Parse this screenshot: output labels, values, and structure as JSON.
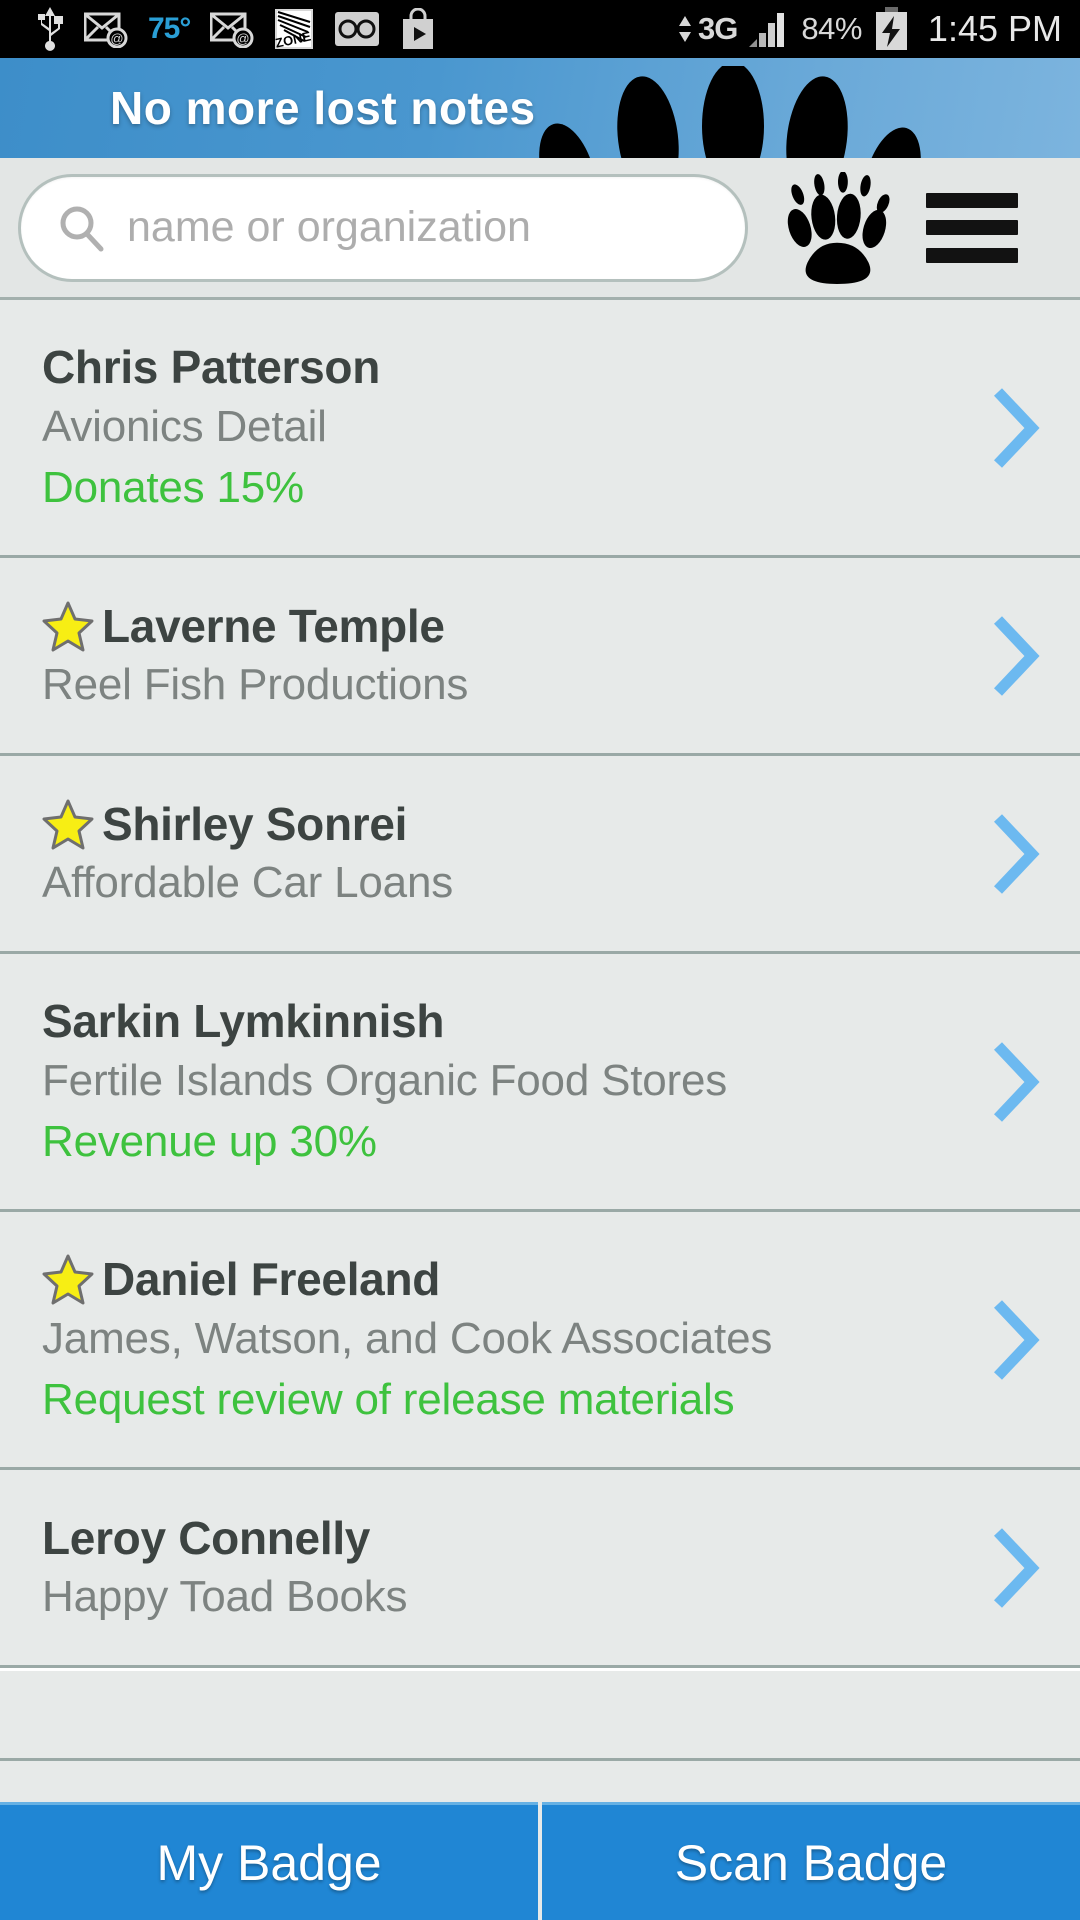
{
  "status_bar": {
    "temperature": "75°",
    "network": "3G",
    "battery": "84%",
    "time": "1:45 PM",
    "icons": [
      "usb-icon",
      "email-icon",
      "email-icon",
      "zone-icon",
      "voicemail-icon",
      "play-store-icon",
      "signal-bars-icon",
      "battery-charging-icon"
    ]
  },
  "banner": {
    "text": "No more lost notes",
    "graphic": "paw-print-graphic",
    "bg_color": "#4a97cf"
  },
  "header": {
    "search_placeholder": "name or organization",
    "search_value": "",
    "search_icon": "search-icon",
    "paw_icon": "paw-print-icon",
    "menu_icon": "hamburger-menu-icon"
  },
  "contacts": [
    {
      "starred": false,
      "name": "Chris Patterson",
      "organization": "Avionics Detail",
      "note": "Donates 15%"
    },
    {
      "starred": true,
      "name": "Laverne Temple",
      "organization": "Reel Fish Productions",
      "note": ""
    },
    {
      "starred": true,
      "name": "Shirley Sonrei",
      "organization": "Affordable Car Loans",
      "note": ""
    },
    {
      "starred": false,
      "name": "Sarkin Lymkinnish",
      "organization": "Fertile Islands Organic Food Stores",
      "note": "Revenue up 30%"
    },
    {
      "starred": true,
      "name": "Daniel Freeland",
      "organization": "James, Watson, and Cook Associates",
      "note": "Request review of release materials"
    },
    {
      "starred": false,
      "name": "Leroy Connelly",
      "organization": "Happy Toad Books",
      "note": ""
    }
  ],
  "bottom_bar": {
    "my_badge_label": "My Badge",
    "scan_badge_label": "Scan Badge"
  },
  "colors": {
    "accent_blue": "#2086d4",
    "note_green": "#3ec23e",
    "chevron_blue": "#6cb9f0",
    "star_yellow": "#f7ee14",
    "list_bg": "#e7eae9"
  }
}
